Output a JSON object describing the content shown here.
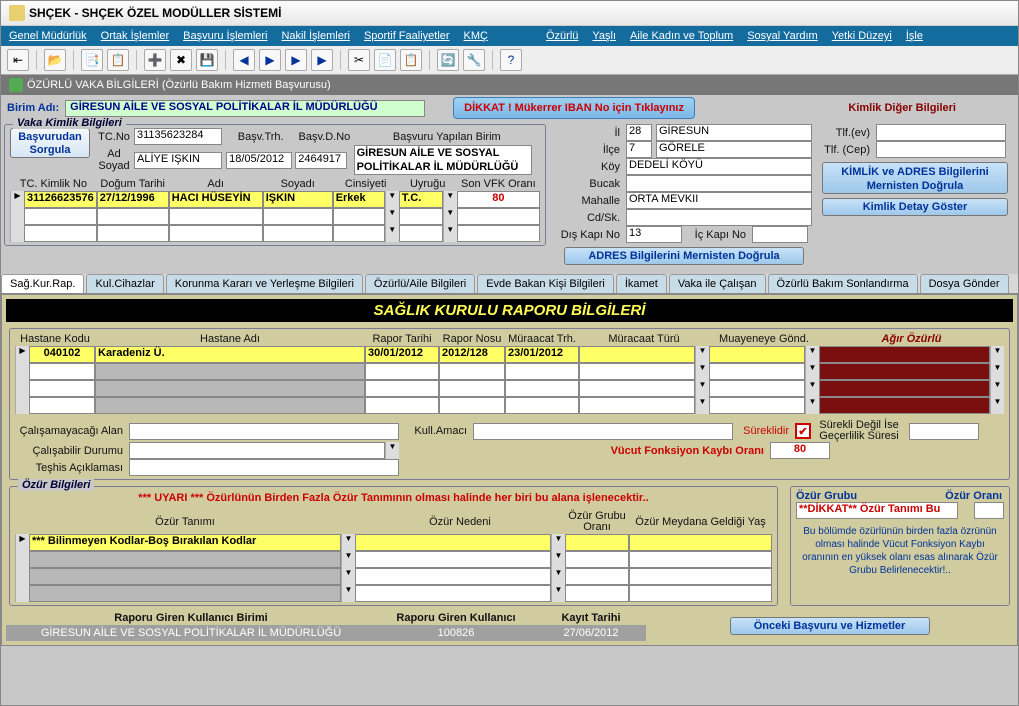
{
  "window": {
    "title": "SHÇEK - SHÇEK ÖZEL MODÜLLER SİSTEMİ"
  },
  "menu": [
    "Genel Müdürlük",
    "Ortak İşlemler",
    "Başvuru İşlemleri",
    "Nakil İşlemleri",
    "Sportif Faaliyetler",
    "KMÇ",
    "Özürlü",
    "Yaşlı",
    "Aile Kadın ve Toplum",
    "Sosyal Yardım",
    "Yetki Düzeyi",
    "İşle"
  ],
  "subheader": "ÖZÜRLÜ VAKA BİLGİLERİ (Özürlü Bakım Hizmeti Başvurusu)",
  "top": {
    "birim_adi_lbl": "Birim Adı:",
    "birim_adi": "GİRESUN AİLE VE SOSYAL POLİTİKALAR İL MÜDÜRLÜĞÜ",
    "dikkat_iban": "DİKKAT ! Mükerrer IBAN No için Tıklayınız",
    "kimlik_diger": "Kimlik Diğer Bilgileri"
  },
  "vaka": {
    "title": "Vaka Kimlik Bilgileri",
    "sorgula": "Başvurudan\nSorgula",
    "tcno_lbl": "TC.No",
    "tcno": "31135623284",
    "basvtrh_lbl": "Başv.Trh.",
    "basvtrh": "18/05/2012",
    "basvdno_lbl": "Başv.D.No",
    "basvdno": "2464917",
    "basvuru_birim_lbl": "Başvuru Yapılan Birim",
    "basvuru_birim": "GİRESUN AİLE VE SOSYAL POLİTİKALAR İL MÜDÜRLÜĞÜ",
    "adsoyad_lbl": "Ad Soyad",
    "adsoyad": "ALİYE IŞKIN",
    "grid_hdrs": [
      "TC. Kimlik No",
      "Doğum Tarihi",
      "Adı",
      "Soyadı",
      "Cinsiyeti",
      "Uyruğu",
      "Son VFK Oranı"
    ],
    "grid_row": [
      "31126623576",
      "27/12/1996",
      "HACI HÜSEYİN",
      "IŞKIN",
      "Erkek",
      "T.C.",
      "80"
    ]
  },
  "adres": {
    "il_lbl": "İl",
    "il_kod": "28",
    "il": "GİRESUN",
    "ilce_lbl": "İlçe",
    "ilce_kod": "7",
    "ilce": "GÖRELE",
    "koy_lbl": "Köy",
    "koy": "DEDELİ KÖYÜ",
    "bucak_lbl": "Bucak",
    "bucak": "",
    "mahalle_lbl": "Mahalle",
    "mahalle": "ORTA MEVKII",
    "cdsk_lbl": "Cd/Sk.",
    "cdsk": "",
    "diskapi_lbl": "Dış Kapı No",
    "diskapi": "13",
    "ickapi_lbl": "İç Kapı No",
    "ickapi": "",
    "tlf_ev_lbl": "Tlf.(ev)",
    "tlf_cep_lbl": "Tlf. (Cep)",
    "mernis_btn": "KİMLİK ve ADRES Bilgilerini Mernisten Doğrula",
    "detay_btn": "Kimlik Detay Göster",
    "adres_mernis_btn": "ADRES Bilgilerini Mernisten Doğrula"
  },
  "tabs": [
    "Sağ.Kur.Rap.",
    "Kul.Cihazlar",
    "Korunma Kararı ve Yerleşme Bilgileri",
    "Özürlü/Aile Bilgileri",
    "Evde Bakan Kişi Bilgileri",
    "İkamet",
    "Vaka ile Çalışan",
    "Özürlü Bakım Sonlandırma",
    "Dosya Gönder"
  ],
  "banner": "SAĞLIK KURULU RAPORU BİLGİLERİ",
  "rapor": {
    "hdrs": [
      "Hastane Kodu",
      "Hastane Adı",
      "Rapor Tarihi",
      "Rapor Nosu",
      "Müraacat Trh.",
      "Müracaat Türü",
      "Muayeneye Gönd.",
      "Ağır Özürlü"
    ],
    "row": [
      "040102",
      "Karadeniz Ü.",
      "30/01/2012",
      "2012/128",
      "23/01/2012",
      "",
      "",
      ""
    ],
    "calisamayacagi_lbl": "Çalışamayacağı Alan",
    "kullamaci_lbl": "Kull.Amacı",
    "sureklidir": "Süreklidir",
    "surekli_degil": "Sürekli Değil İse Geçerlilik Süresi",
    "calisabilir_lbl": "Çalışabilir Durumu",
    "teshis_lbl": "Teşhis Açıklaması",
    "vucut_lbl": "Vücut Fonksiyon Kaybı Oranı",
    "vucut": "80"
  },
  "ozur": {
    "title": "Özür Bilgileri",
    "uyari": "*** UYARI *** Özürlünün Birden Fazla Özür Tanımının olması halinde her biri bu alana işlenecektir..",
    "hdrs": [
      "Özür Tanımı",
      "Özür Nedeni",
      "Özür Grubu Oranı",
      "Özür Meydana Geldiği Yaş"
    ],
    "row0": "*** Bilinmeyen Kodlar-Boş Bırakılan Kodlar",
    "grup_title": "Özür Grubu",
    "grup_orani": "Özür Oranı",
    "dikkat": "**DİKKAT** Özür Tanımı Bu",
    "info": "Bu bölümde özürlünün birden fazla özrünün olması halinde Vücut Fonksiyon Kaybı oranının en yüksek olanı esas alınarak Özür Grubu Belirlenecektir!.."
  },
  "footer": {
    "rgkb_lbl": "Raporu Giren Kullanıcı Birimi",
    "rgk_lbl": "Raporu Giren Kullanıcı",
    "kt_lbl": "Kayıt Tarihi",
    "rgkb": "GİRESUN AİLE VE SOSYAL POLİTİKALAR İL MÜDÜRLÜĞÜ",
    "rgk": "100826",
    "kt": "27/06/2012",
    "onceki": "Önceki Başvuru ve Hizmetler"
  },
  "chart_data": null
}
